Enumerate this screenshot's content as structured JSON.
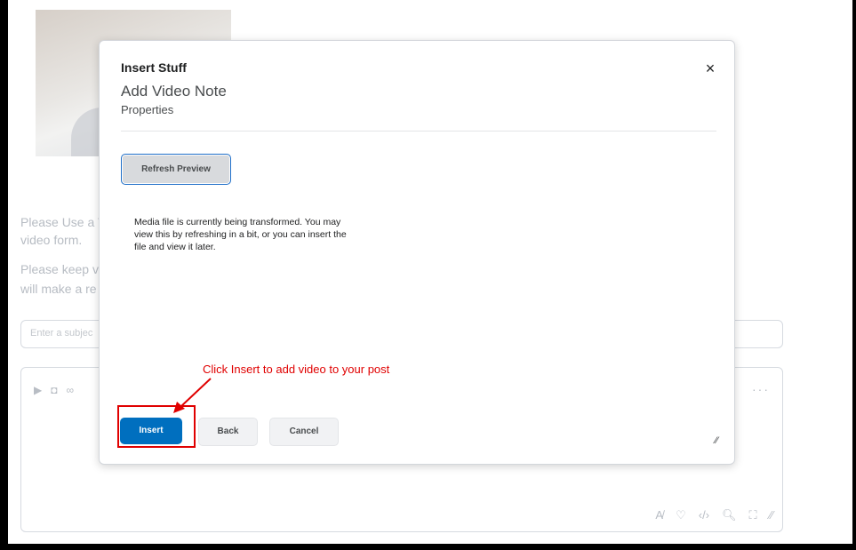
{
  "background": {
    "line1": "Please Use a V",
    "line2": "video form.",
    "line3": "Please keep vi",
    "line4": "will make a re",
    "subject_placeholder": "Enter a subjec"
  },
  "dialog": {
    "title": "Insert Stuff",
    "subtitle": "Add Video Note",
    "section": "Properties",
    "close_icon": "×",
    "refresh_label": "Refresh Preview",
    "message": "Media file is currently being transformed. You may view this by refreshing in a bit, or you can insert the file and view it later.",
    "insert_label": "Insert",
    "back_label": "Back",
    "cancel_label": "Cancel"
  },
  "annotation": {
    "text": "Click Insert to add video to your post",
    "color": "#e00000"
  },
  "colors": {
    "primary": "#006fbf",
    "focus_outline": "#1e6ec8"
  }
}
